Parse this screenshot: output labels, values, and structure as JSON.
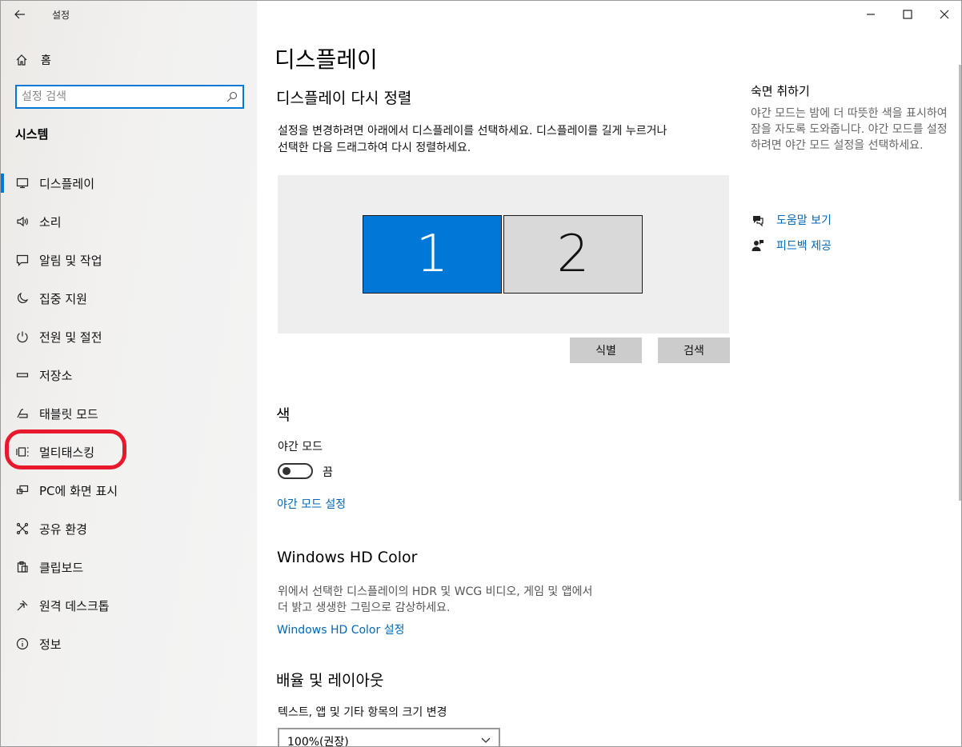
{
  "app": {
    "title": "설정"
  },
  "sidebar": {
    "home_label": "홈",
    "search_placeholder": "설정 검색",
    "section_title": "시스템",
    "items": [
      {
        "label": "디스플레이",
        "icon": "monitor-icon",
        "active": true
      },
      {
        "label": "소리",
        "icon": "speaker-icon"
      },
      {
        "label": "알림 및 작업",
        "icon": "notification-icon"
      },
      {
        "label": "집중 지원",
        "icon": "moon-icon"
      },
      {
        "label": "전원 및 절전",
        "icon": "power-icon"
      },
      {
        "label": "저장소",
        "icon": "storage-icon"
      },
      {
        "label": "태블릿 모드",
        "icon": "tablet-icon"
      },
      {
        "label": "멀티태스킹",
        "icon": "multitasking-icon"
      },
      {
        "label": "PC에 화면 표시",
        "icon": "project-icon"
      },
      {
        "label": "공유 환경",
        "icon": "shared-icon"
      },
      {
        "label": "클립보드",
        "icon": "clipboard-icon"
      },
      {
        "label": "원격 데스크톱",
        "icon": "remote-desktop-icon"
      },
      {
        "label": "정보",
        "icon": "info-icon"
      }
    ]
  },
  "main": {
    "page_title": "디스플레이",
    "rearrange_title": "디스플레이 다시 정렬",
    "rearrange_desc_line1": "설정을 변경하려면 아래에서 디스플레이를 선택하세요. 디스플레이를 길게 누르거나",
    "rearrange_desc_line2": "선택한 다음 드래그하여 다시 정렬하세요.",
    "monitors": [
      "1",
      "2"
    ],
    "identify_label": "식별",
    "detect_label": "검색",
    "color_title": "색",
    "night_light_label": "야간 모드",
    "night_light_state": "끔",
    "night_light_settings_link": "야간 모드 설정",
    "hd_color_title": "Windows HD Color",
    "hd_color_desc_line1": "위에서 선택한 디스플레이의 HDR 및 WCG 비디오, 게임 및 앱에서",
    "hd_color_desc_line2": "더 밝고 생생한 그림으로 감상하세요.",
    "hd_color_link": "Windows HD Color 설정",
    "scale_title": "배율 및 레이아웃",
    "scale_label": "텍스트, 앱 및 기타 항목의 크기 변경",
    "scale_value": "100%(권장)"
  },
  "right": {
    "title": "숙면 취하기",
    "desc": "야간 모드는 밤에 더 따뜻한 색을 표시하여 잠을 자도록 도와줍니다. 야간 모드를 설정하려면 야간 모드 설정을 선택하세요.",
    "help_link": "도움말 보기",
    "feedback_link": "피드백 제공"
  },
  "colors": {
    "accent": "#0078d7",
    "link": "#0067b8",
    "highlight": "#e8192c"
  }
}
